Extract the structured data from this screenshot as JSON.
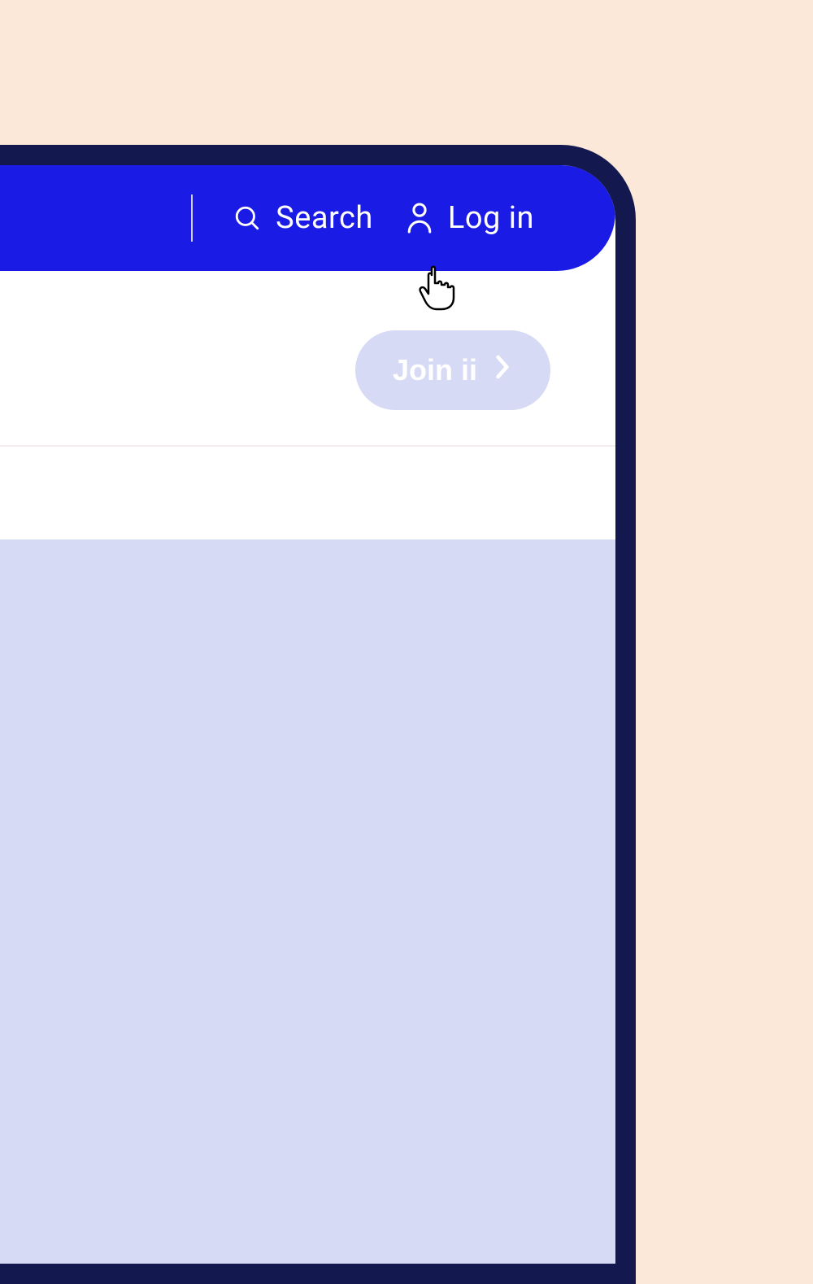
{
  "topbar": {
    "search_label": "Search",
    "login_label": "Log in"
  },
  "cta": {
    "join_label": "Join ii"
  },
  "colors": {
    "frame": "#13184f",
    "topbar": "#1b1be6",
    "lavender": "#d7daf4",
    "page_bg": "#fbe8d9"
  }
}
